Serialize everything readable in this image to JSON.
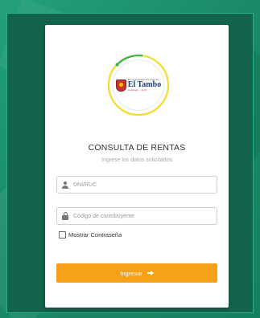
{
  "logo": {
    "top_text": "Municipalidad Distrital de",
    "name": "El Tambo",
    "sub_text": "Huancayo - Junín",
    "ring_colors": {
      "yellow": "#f4dc2a",
      "green": "#38b54a"
    }
  },
  "form": {
    "title": "CONSULTA DE RENTAS",
    "subtitle": "Ingrese los datos solicitados",
    "id_field": {
      "placeholder": "DNI/RUC",
      "icon": "user-icon"
    },
    "code_field": {
      "placeholder": "Código de contribuyente",
      "icon": "lock-icon"
    },
    "show_password": {
      "label": "Mostrar Contraseña",
      "checked": false
    },
    "submit": {
      "label": "Ingresar",
      "icon": "arrow-right-icon",
      "color": "#f7a01a"
    }
  },
  "colors": {
    "background": "#1d8f6e",
    "accent": "#f7a01a"
  }
}
